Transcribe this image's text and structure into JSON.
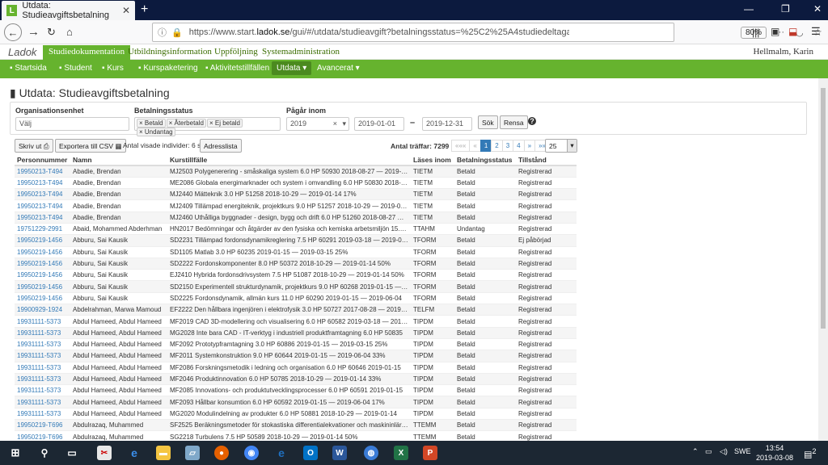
{
  "browser": {
    "tab_title": "Utdata: Studieavgiftsbetalning",
    "favicon": "L",
    "url_prefix": "https://www.start.",
    "url_domain": "ladok.se",
    "url_rest": "/gui/#/utdata/studieavgift?betalningsstatus=%25C2%25A4studiedeltagande",
    "zoom": "80%"
  },
  "app": {
    "logo": "Ladok",
    "tabs": [
      "Studiedokumentation",
      "Utbildningsinformation",
      "Uppföljning",
      "Systemadministration"
    ],
    "user": "Hellmalm, Karin"
  },
  "nav": {
    "items": [
      "Startsida",
      "Student",
      "Kurs",
      "Kurspaketering",
      "Aktivitetstillfällen",
      "Utdata",
      "Avancerat"
    ]
  },
  "page": {
    "title": "Utdata: Studieavgiftsbetalning"
  },
  "filters": {
    "org_label": "Organisationsenhet",
    "org_placeholder": "Välj",
    "status_label": "Betalningsstatus",
    "status_chips": [
      "Betald",
      "Återbetald",
      "Ej betald",
      "Undantag"
    ],
    "period_label": "Pågår inom",
    "year": "2019",
    "from": "2019-01-01",
    "dash": "–",
    "to": "2019-12-31",
    "search": "Sök",
    "clear": "Rensa",
    "help": "?"
  },
  "toolbar": {
    "print": "Skriv ut",
    "export": "Exportera till CSV",
    "shown": "Antal visade individer: 6 st",
    "addresses": "Adresslista",
    "hits": "Antal träffar: 7299",
    "pages": [
      "«««",
      "«",
      "1",
      "2",
      "3",
      "4",
      "»",
      "»»"
    ],
    "page_size": "25"
  },
  "table": {
    "headers": [
      "Personnummer",
      "Namn",
      "Kurstillfälle",
      "Läses inom",
      "Betalningsstatus",
      "Tillstånd"
    ],
    "rows": [
      [
        "19950213-T494",
        "Abadie, Brendan",
        "MJ2503 Polygenerering - småskaliga system 6.0 HP 50930 2018-08-27 — 2019-01-14",
        "TIETM",
        "Betald",
        "Registrerad"
      ],
      [
        "19950213-T494",
        "Abadie, Brendan",
        "ME2086 Globala energimarknader och system i omvandling 6.0 HP 50830 2018-08-27",
        "TIETM",
        "Betald",
        "Registrerad"
      ],
      [
        "19950213-T494",
        "Abadie, Brendan",
        "MJ2440 Mätteknik 3.0 HP 51258 2018-10-29 — 2019-01-14 17%",
        "TIETM",
        "Betald",
        "Registrerad"
      ],
      [
        "19950213-T494",
        "Abadie, Brendan",
        "MJ2409 Tillämpad energiteknik, projektkurs 9.0 HP 51257 2018-10-29 — 2019-06-04",
        "TIETM",
        "Betald",
        "Registrerad"
      ],
      [
        "19950213-T494",
        "Abadie, Brendan",
        "MJ2460 Uthålliga byggnader - design, bygg och drift 6.0 HP 51260 2018-08-27 — 2019-01-14",
        "TIETM",
        "Betald",
        "Registrerad"
      ],
      [
        "19751229-2991",
        "Abaid, Mohammed Abderhman",
        "HN2017 Bedömningar och åtgärder av den fysiska och kemiska arbetsmiljön 15.0 HP",
        "TTAHM",
        "Undantag",
        "Registrerad"
      ],
      [
        "19950219-1456",
        "Abburu, Sai Kausik",
        "SD2231 Tillämpad fordonsdynamikreglering 7.5 HP 60291 2019-03-18 — 2019-06-04",
        "TFORM",
        "Betald",
        "Ej påbörjad"
      ],
      [
        "19950219-1456",
        "Abburu, Sai Kausik",
        "SD1105 Matlab 3.0 HP 60235 2019-01-15 — 2019-03-15 25%",
        "TFORM",
        "Betald",
        "Registrerad"
      ],
      [
        "19950219-1456",
        "Abburu, Sai Kausik",
        "SD2222 Fordonskomponenter 8.0 HP 50372 2018-10-29 — 2019-01-14 50%",
        "TFORM",
        "Betald",
        "Registrerad"
      ],
      [
        "19950219-1456",
        "Abburu, Sai Kausik",
        "EJ2410 Hybrida fordonsdrivsystem 7.5 HP 51087 2018-10-29 — 2019-01-14 50%",
        "TFORM",
        "Betald",
        "Registrerad"
      ],
      [
        "19950219-1456",
        "Abburu, Sai Kausik",
        "SD2150 Experimentell strukturdynamik, projektkurs 9.0 HP 60268 2019-01-15 — 2019-06-04",
        "TFORM",
        "Betald",
        "Registrerad"
      ],
      [
        "19950219-1456",
        "Abburu, Sai Kausik",
        "SD2225 Fordonsdynamik, allmän kurs 11.0 HP 60290 2019-01-15 — 2019-06-04",
        "TFORM",
        "Betald",
        "Registrerad"
      ],
      [
        "19900929-1924",
        "Abdelrahman, Marwa Mamoud",
        "EF2222 Den hållbara ingenjören i elektrofysik 3.0 HP 50727 2017-08-28 — 2019-06-04",
        "TELFM",
        "Betald",
        "Registrerad"
      ],
      [
        "19931111-5373",
        "Abdul Hameed, Abdul Hameed",
        "MF2019 CAD 3D-modellering och visualisering 6.0 HP 60582 2019-03-18 — 2019-06-04",
        "TIPDM",
        "Betald",
        "Registrerad"
      ],
      [
        "19931111-5373",
        "Abdul Hameed, Abdul Hameed",
        "MG2028 Inte bara CAD - IT-verktyg i industriell produktframtagning 6.0 HP 50835",
        "TIPDM",
        "Betald",
        "Registrerad"
      ],
      [
        "19931111-5373",
        "Abdul Hameed, Abdul Hameed",
        "MF2092 Prototypframtagning 3.0 HP 60886 2019-01-15 — 2019-03-15 25%",
        "TIPDM",
        "Betald",
        "Registrerad"
      ],
      [
        "19931111-5373",
        "Abdul Hameed, Abdul Hameed",
        "MF2011 Systemkonstruktion 9.0 HP 60644 2019-01-15 — 2019-06-04 33%",
        "TIPDM",
        "Betald",
        "Registrerad"
      ],
      [
        "19931111-5373",
        "Abdul Hameed, Abdul Hameed",
        "MF2086 Forskningsmetodik i ledning och organisation 6.0 HP 60646 2019-01-15",
        "TIPDM",
        "Betald",
        "Registrerad"
      ],
      [
        "19931111-5373",
        "Abdul Hameed, Abdul Hameed",
        "MF2046 Produktinnovation 6.0 HP 50785 2018-10-29 — 2019-01-14 33%",
        "TIPDM",
        "Betald",
        "Registrerad"
      ],
      [
        "19931111-5373",
        "Abdul Hameed, Abdul Hameed",
        "MF2085 Innovations- och produktutvecklingsprocesser 6.0 HP 60591 2019-01-15",
        "TIPDM",
        "Betald",
        "Registrerad"
      ],
      [
        "19931111-5373",
        "Abdul Hameed, Abdul Hameed",
        "MF2093 Hållbar konsumtion 6.0 HP 60592 2019-01-15 — 2019-06-04 17%",
        "TIPDM",
        "Betald",
        "Registrerad"
      ],
      [
        "19931111-5373",
        "Abdul Hameed, Abdul Hameed",
        "MG2020 Modulindelning av produkter 6.0 HP 50881 2018-10-29 — 2019-01-14",
        "TIPDM",
        "Betald",
        "Registrerad"
      ],
      [
        "19950219-T696",
        "Abdulrazaq, Muhammed",
        "SF2525 Beräkningsmetoder för stokastiska differentialekvationer och maskininlärning",
        "TTEMM",
        "Betald",
        "Registrerad"
      ],
      [
        "19950219-T696",
        "Abdulrazaq, Muhammed",
        "SG2218 Turbulens 7.5 HP 50589 2018-10-29 — 2019-01-14 50%",
        "TTEMM",
        "Betald",
        "Registrerad"
      ]
    ]
  },
  "taskbar": {
    "lang": "SWE",
    "time": "13:54",
    "date": "2019-03-08",
    "notif": "2"
  }
}
